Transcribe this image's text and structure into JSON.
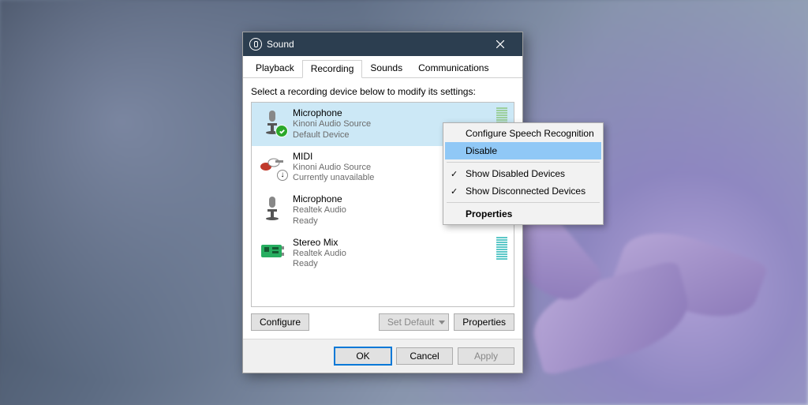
{
  "window": {
    "title": "Sound"
  },
  "tabs": {
    "playback": "Playback",
    "recording": "Recording",
    "sounds": "Sounds",
    "communications": "Communications"
  },
  "instruction": "Select a recording device below to modify its settings:",
  "devices": [
    {
      "name": "Microphone",
      "line2": "Kinoni Audio Source",
      "line3": "Default Device"
    },
    {
      "name": "MIDI",
      "line2": "Kinoni Audio Source",
      "line3": "Currently unavailable"
    },
    {
      "name": "Microphone",
      "line2": "Realtek Audio",
      "line3": "Ready"
    },
    {
      "name": "Stereo Mix",
      "line2": "Realtek Audio",
      "line3": "Ready"
    }
  ],
  "buttons": {
    "configure": "Configure",
    "setdefault": "Set Default",
    "properties": "Properties",
    "ok": "OK",
    "cancel": "Cancel",
    "apply": "Apply"
  },
  "context_menu": {
    "configure_speech": "Configure Speech Recognition",
    "disable": "Disable",
    "show_disabled": "Show Disabled Devices",
    "show_disconnected": "Show Disconnected Devices",
    "properties": "Properties"
  }
}
